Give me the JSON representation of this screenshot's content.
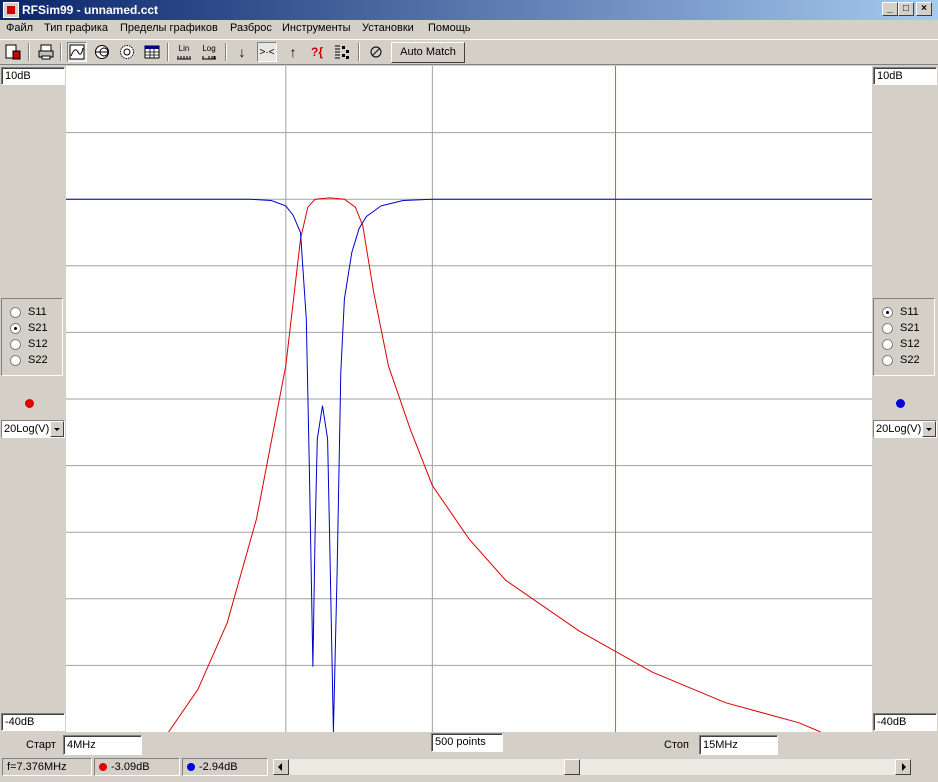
{
  "window": {
    "title": "RFSim99 - unnamed.cct"
  },
  "menu": [
    "Файл",
    "Тип графика",
    "Пределы графиков",
    "Разброс",
    "Инструменты",
    "Установки",
    "Помощь"
  ],
  "toolbar": {
    "lin_label": "Lin",
    "log_label": "Log",
    "auto_match_label": "Auto Match",
    "icons": [
      "new-icon",
      "print-icon",
      "rect-plot-icon",
      "smith-chart-icon",
      "polar-chart-icon",
      "table-icon",
      "lin-scale-icon",
      "log-scale-icon",
      "marker-down-icon",
      "marker-center-icon",
      "marker-up-icon",
      "help-icon",
      "monte-carlo-icon",
      "tune-icon"
    ]
  },
  "left_panel": {
    "top_scale": "10dB",
    "bottom_scale": "-40dB",
    "params": [
      "S11",
      "S21",
      "S12",
      "S22"
    ],
    "selected": "S21",
    "trace_color": "#dd0000",
    "mode": "20Log(V)"
  },
  "right_panel": {
    "top_scale": "10dB",
    "bottom_scale": "-40dB",
    "params": [
      "S11",
      "S21",
      "S12",
      "S22"
    ],
    "selected": "S11",
    "trace_color": "#0000cc",
    "mode": "20Log(V)"
  },
  "sweep": {
    "start_label": "Старт",
    "start_value": "4MHz",
    "points": "500 points",
    "stop_label": "Стоп",
    "stop_value": "15MHz"
  },
  "status": {
    "frequency": "f=7.376MHz",
    "red_value": "-3.09dB",
    "blue_value": "-2.94dB"
  },
  "chart_data": {
    "type": "line",
    "x_range_mhz": [
      4,
      15
    ],
    "y_range_db": [
      -40,
      10
    ],
    "grid": true,
    "marker_frequency_mhz": 11.5,
    "series": [
      {
        "name": "S21",
        "color": "#dd0000",
        "points": [
          [
            5.4,
            -40
          ],
          [
            5.8,
            -36.8
          ],
          [
            6.2,
            -31.8
          ],
          [
            6.6,
            -24
          ],
          [
            7.0,
            -12.5
          ],
          [
            7.2,
            -3
          ],
          [
            7.3,
            -0.6
          ],
          [
            7.4,
            0
          ],
          [
            7.6,
            0.1
          ],
          [
            7.8,
            0
          ],
          [
            7.95,
            -0.6
          ],
          [
            8.05,
            -2
          ],
          [
            8.2,
            -7
          ],
          [
            8.4,
            -12.5
          ],
          [
            8.7,
            -17.3
          ],
          [
            9.0,
            -21.5
          ],
          [
            9.5,
            -25.5
          ],
          [
            10,
            -28.6
          ],
          [
            11,
            -32.4
          ],
          [
            12,
            -35.5
          ],
          [
            13,
            -37.8
          ],
          [
            14,
            -39.3
          ],
          [
            14.3,
            -40
          ]
        ]
      },
      {
        "name": "S11",
        "color": "#0000cc",
        "points": [
          [
            4,
            0
          ],
          [
            6.5,
            0
          ],
          [
            6.8,
            -0.1
          ],
          [
            7.0,
            -0.5
          ],
          [
            7.1,
            -1.2
          ],
          [
            7.2,
            -2.5
          ],
          [
            7.28,
            -9
          ],
          [
            7.32,
            -20
          ],
          [
            7.37,
            -35.1
          ],
          [
            7.4,
            -25
          ],
          [
            7.43,
            -18
          ],
          [
            7.5,
            -15.5
          ],
          [
            7.57,
            -18
          ],
          [
            7.6,
            -26
          ],
          [
            7.65,
            -40
          ],
          [
            7.7,
            -28
          ],
          [
            7.75,
            -13
          ],
          [
            7.8,
            -7.5
          ],
          [
            7.9,
            -4
          ],
          [
            8.0,
            -2.2
          ],
          [
            8.1,
            -1.3
          ],
          [
            8.3,
            -0.5
          ],
          [
            8.6,
            -0.1
          ],
          [
            9.0,
            0
          ],
          [
            15,
            0
          ]
        ]
      }
    ]
  }
}
